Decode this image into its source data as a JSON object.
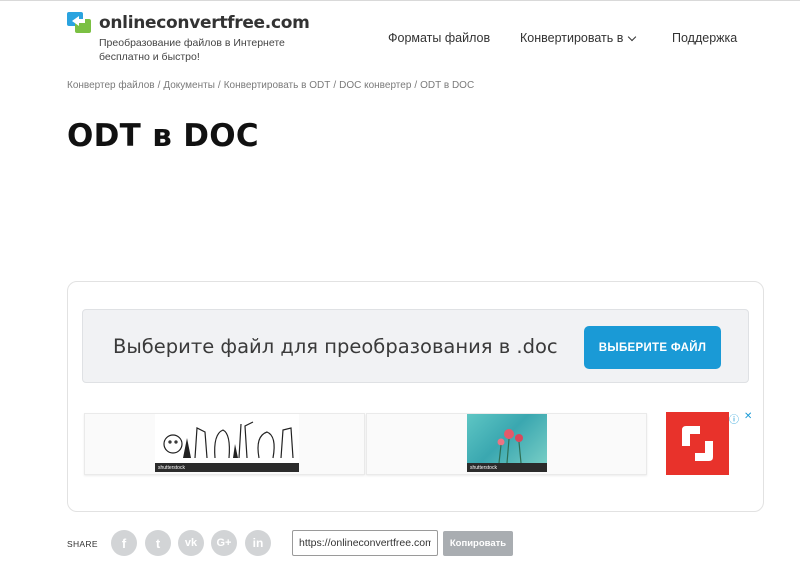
{
  "header": {
    "logo_text": "onlineconvertfree.com",
    "tagline": "Преобразование файлов в Интернете бесплатно и быстро!",
    "nav": {
      "formats": "Форматы файлов",
      "convert": "Конвертировать в",
      "support": "Поддержка"
    }
  },
  "breadcrumb": [
    "Конвертер файлов",
    "Документы",
    "Конвертировать в ODT",
    "DOC конвертер",
    "ODT в DOC"
  ],
  "breadcrumb_separator": "/",
  "page_title": "ODT в DOC",
  "converter": {
    "prompt": "Выберите файл для преобразования в .doc",
    "button_label": "ВЫБЕРИТЕ ФАЙЛ"
  },
  "ads": {
    "provider_label": "shutterstock",
    "info_symbol": "ⓘ",
    "close_symbol": "✕"
  },
  "share": {
    "label": "SHARE",
    "networks": [
      {
        "name": "facebook",
        "glyph": "f"
      },
      {
        "name": "twitter",
        "glyph": "t"
      },
      {
        "name": "vk",
        "glyph": "vk"
      },
      {
        "name": "google-plus",
        "glyph": "G+"
      },
      {
        "name": "linkedin",
        "glyph": "in"
      }
    ],
    "url_value": "https://onlineconvertfree.com",
    "copy_label": "Копировать"
  },
  "colors": {
    "accent": "#1a9ad6",
    "ad_red": "#e8322b",
    "social_gray": "#d2d4d6"
  }
}
